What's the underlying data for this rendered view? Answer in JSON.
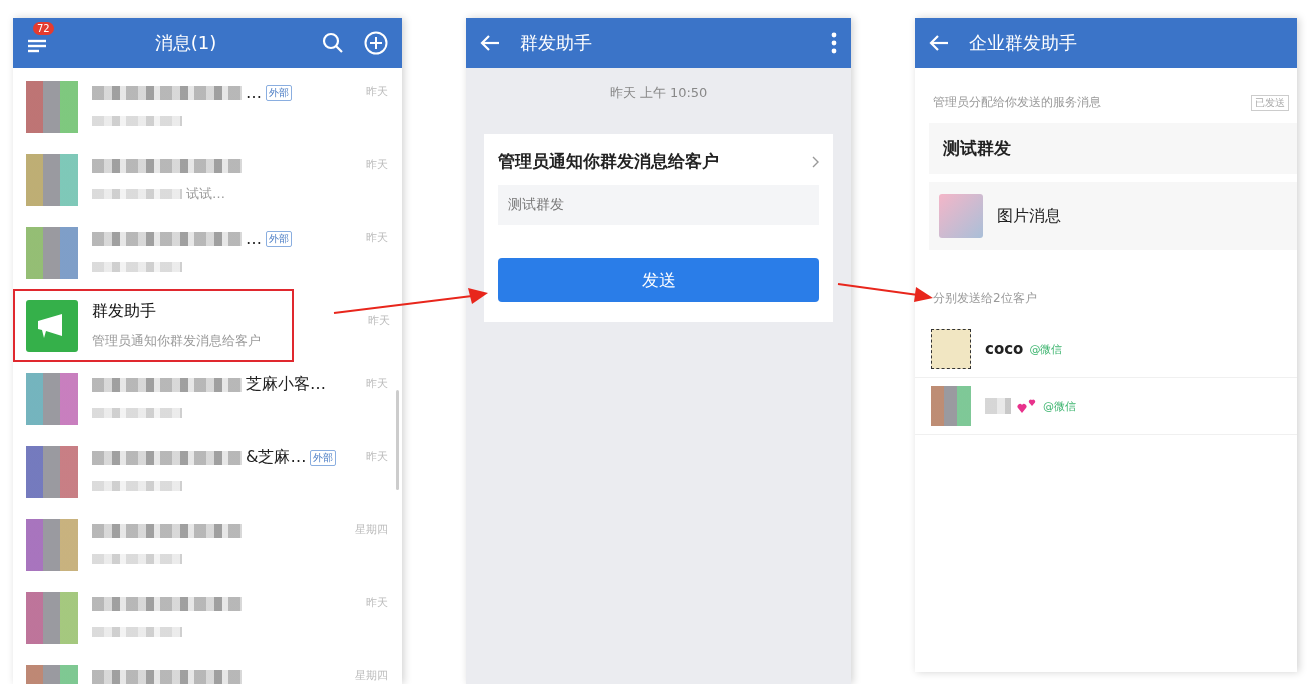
{
  "message_list": {
    "title": "消息(1)",
    "unread_badge": "72",
    "conversations": [
      {
        "kind": "blurred",
        "name_tail": "…",
        "tag": "外部",
        "time": "昨天",
        "highlighted": false
      },
      {
        "kind": "blurred",
        "preview_tail": "试试…",
        "time": "昨天",
        "highlighted": false
      },
      {
        "kind": "blurred",
        "name_tail": "…",
        "tag": "外部",
        "time": "昨天",
        "highlighted": false
      },
      {
        "kind": "assistant",
        "name": "群发助手",
        "preview": "管理员通知你群发消息给客户",
        "time": "昨天",
        "highlighted": true
      },
      {
        "kind": "blurred",
        "name_tail": "芝麻小客…",
        "time": "昨天",
        "highlighted": false
      },
      {
        "kind": "blurred",
        "name_tail": "&芝麻…",
        "tag": "外部",
        "time": "昨天",
        "highlighted": false
      },
      {
        "kind": "blurred",
        "time": "星期四",
        "highlighted": false
      },
      {
        "kind": "blurred",
        "time": "昨天",
        "highlighted": false
      },
      {
        "kind": "blurred",
        "time": "星期四",
        "highlighted": false
      }
    ]
  },
  "broadcast_chat": {
    "title": "群发助手",
    "timestamp": "昨天 上午 10:50",
    "card_title": "管理员通知你群发消息给客户",
    "message": "测试群发",
    "send_button": "发送"
  },
  "broadcast_detail": {
    "title": "企业群发助手",
    "section_label": "管理员分配给你发送的服务消息",
    "status": "已发送",
    "text_message": "测试群发",
    "image_message": "图片消息",
    "recipients_heading": "分别发送给2位客户",
    "recipients": [
      {
        "kind": "named",
        "name": "coco",
        "source": "@微信"
      },
      {
        "kind": "blurred",
        "source": "@微信"
      }
    ]
  }
}
